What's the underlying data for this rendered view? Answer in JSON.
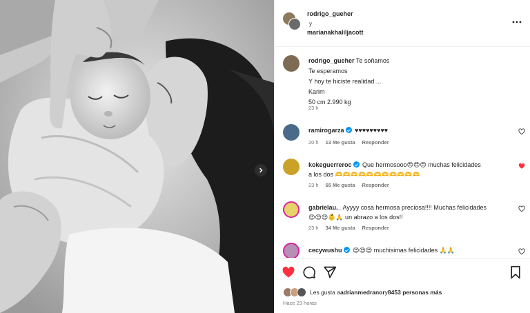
{
  "header": {
    "user1": "rodrigo_gueher",
    "connector": "y",
    "user2": "marianakhaliljacott",
    "more_icon": "more-horizontal-icon"
  },
  "caption": {
    "username": "rodrigo_gueher",
    "lines": [
      "Te soñamos",
      "Te esperamos",
      "Y hoy te hiciste realidad ...",
      "Karim",
      "50 cm 2.990 kg"
    ],
    "time": "23 h"
  },
  "comments": [
    {
      "username": "ramirogarza",
      "verified": true,
      "text": "♥♥♥♥♥♥♥♥♥",
      "text_line2": "",
      "time": "20 h",
      "likes": "13 Me gusta",
      "reply": "Responder",
      "liked": false
    },
    {
      "username": "kokeguerreroc",
      "verified": true,
      "text": "Que hermosooo😍😍😍 muchas felicidades",
      "text_line2": "a los dos 🫶🫶🫶🫶🫶🫶🫶🫶🫶🫶🫶",
      "time": "23 h",
      "likes": "65 Me gusta",
      "reply": "Responder",
      "liked": true
    },
    {
      "username": "gabrielau._",
      "verified": false,
      "text": "Ayyyy cosa hermosa preciosa!!!! Muchas felicidades",
      "text_line2": "😍😍😍👶🙏 un abrazo a los dos!!",
      "time": "23 h",
      "likes": "34 Me gusta",
      "reply": "Responder",
      "liked": false
    },
    {
      "username": "cecywushu",
      "verified": true,
      "text": "😍😍😍 muchisimas felicidades 🙏🙏",
      "text_line2": "",
      "time": "",
      "likes": "",
      "reply": "",
      "liked": false
    }
  ],
  "actions": {
    "like_icon": "heart-filled-icon",
    "comment_icon": "comment-icon",
    "share_icon": "send-icon",
    "save_icon": "bookmark-icon"
  },
  "likes": {
    "prefix": "Les gusta a ",
    "user": "adrianmedranor",
    "middle": " y ",
    "count": "8453 personas más"
  },
  "posted_ago": "Hace 23 horas",
  "colors": {
    "like_red": "#ff3040",
    "verified_blue": "#0095f6",
    "meta_gray": "#737373"
  }
}
